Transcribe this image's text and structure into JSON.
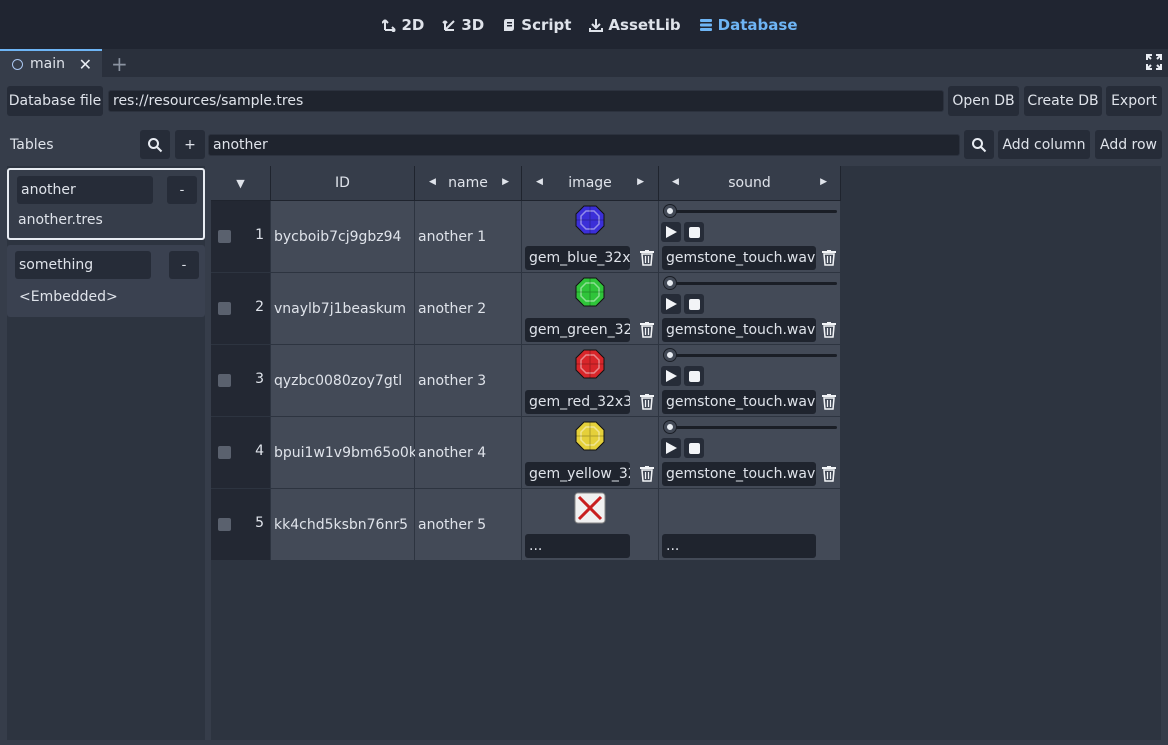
{
  "workspaces": [
    {
      "label": "2D",
      "icon": "2d-icon",
      "active": false
    },
    {
      "label": "3D",
      "icon": "3d-icon",
      "active": false
    },
    {
      "label": "Script",
      "icon": "script-icon",
      "active": false
    },
    {
      "label": "AssetLib",
      "icon": "assetlib-icon",
      "active": false
    },
    {
      "label": "Database",
      "icon": "database-icon",
      "active": true
    }
  ],
  "scene_tab": {
    "label": "main"
  },
  "toolbar": {
    "db_file_label": "Database file",
    "db_path": "res://resources/sample.tres",
    "open_db": "Open DB",
    "create_db": "Create DB",
    "export": "Export"
  },
  "tables_panel": {
    "label": "Tables",
    "add": "+",
    "tables": [
      {
        "name": "another",
        "file": "another.tres",
        "selected": true,
        "remove": "-"
      },
      {
        "name": "something",
        "file": "<Embedded>",
        "selected": false,
        "remove": "-"
      }
    ]
  },
  "table_toolbar": {
    "current_table": "another",
    "add_column": "Add column",
    "add_row": "Add row"
  },
  "columns": [
    "ID",
    "name",
    "image",
    "sound"
  ],
  "rows": [
    {
      "index": "1",
      "id": "bycboib7cj9gbz94",
      "name": "another 1",
      "image": "gem_blue_32x",
      "gem": "blue",
      "sound": "gemstone_touch.wav"
    },
    {
      "index": "2",
      "id": "vnaylb7j1beaskum",
      "name": "another 2",
      "image": "gem_green_32",
      "gem": "green",
      "sound": "gemstone_touch.wav"
    },
    {
      "index": "3",
      "id": "qyzbc0080zoy7gtl",
      "name": "another 3",
      "image": "gem_red_32x3",
      "gem": "red",
      "sound": "gemstone_touch.wav"
    },
    {
      "index": "4",
      "id": "bpui1w1v9bm65o0k",
      "name": "another 4",
      "image": "gem_yellow_32",
      "gem": "yellow",
      "sound": "gemstone_touch.wav"
    },
    {
      "index": "5",
      "id": "kk4chd5ksbn76nr5",
      "name": "another 5",
      "image": "...",
      "gem": "missing",
      "sound": "..."
    }
  ],
  "colors": {
    "accent": "#6eb5f5",
    "gem_blue": "#3b2fd8",
    "gem_green": "#2fc43a",
    "gem_red": "#d8262a",
    "gem_yellow": "#e5d03a"
  }
}
